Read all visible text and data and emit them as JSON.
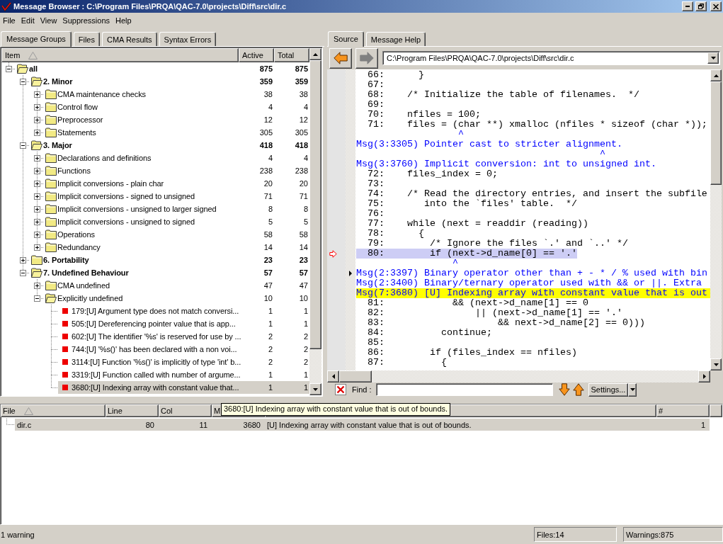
{
  "window": {
    "title": "Message Browser : C:\\Program Files\\PRQA\\QAC-7.0\\projects\\Diff\\src\\dir.c"
  },
  "menu": [
    "File",
    "Edit",
    "View",
    "Suppressions",
    "Help"
  ],
  "left_tabs": [
    {
      "label": "Message Groups",
      "selected": true
    },
    {
      "label": "Files",
      "selected": false
    },
    {
      "label": "CMA Results",
      "selected": false
    },
    {
      "label": "Syntax Errors",
      "selected": false
    }
  ],
  "message_groups": {
    "columns": [
      {
        "label": "Item",
        "sorted": true
      },
      {
        "label": "Active",
        "sorted": false
      },
      {
        "label": "Total",
        "sorted": false
      }
    ],
    "items": [
      {
        "kind": "group",
        "label": "all",
        "active": "875",
        "total": "875",
        "expanded": true,
        "selected": false,
        "children": [
          {
            "kind": "group",
            "label": "2. Minor",
            "active": "359",
            "total": "359",
            "expanded": true,
            "selected": false,
            "children": [
              {
                "kind": "group",
                "label": "CMA maintenance checks",
                "active": "38",
                "total": "38",
                "expanded": false,
                "selected": false
              },
              {
                "kind": "group",
                "label": "Control flow",
                "active": "4",
                "total": "4",
                "expanded": false,
                "selected": false
              },
              {
                "kind": "group",
                "label": "Preprocessor",
                "active": "12",
                "total": "12",
                "expanded": false,
                "selected": false
              },
              {
                "kind": "group",
                "label": "Statements",
                "active": "305",
                "total": "305",
                "expanded": false,
                "selected": false
              }
            ]
          },
          {
            "kind": "group",
            "label": "3. Major",
            "active": "418",
            "total": "418",
            "expanded": true,
            "selected": false,
            "children": [
              {
                "kind": "group",
                "label": "Declarations and definitions",
                "active": "4",
                "total": "4",
                "expanded": false,
                "selected": false
              },
              {
                "kind": "group",
                "label": "Functions",
                "active": "238",
                "total": "238",
                "expanded": false,
                "selected": false
              },
              {
                "kind": "group",
                "label": "Implicit conversions - plain char",
                "active": "20",
                "total": "20",
                "expanded": false,
                "selected": false
              },
              {
                "kind": "group",
                "label": "Implicit conversions - signed to unsigned",
                "active": "71",
                "total": "71",
                "expanded": false,
                "selected": false
              },
              {
                "kind": "group",
                "label": "Implicit conversions - unsigned to larger signed",
                "active": "8",
                "total": "8",
                "expanded": false,
                "selected": false
              },
              {
                "kind": "group",
                "label": "Implicit conversions - unsigned to signed",
                "active": "5",
                "total": "5",
                "expanded": false,
                "selected": false
              },
              {
                "kind": "group",
                "label": "Operations",
                "active": "58",
                "total": "58",
                "expanded": false,
                "selected": false
              },
              {
                "kind": "group",
                "label": "Redundancy",
                "active": "14",
                "total": "14",
                "expanded": false,
                "selected": false
              }
            ]
          },
          {
            "kind": "group",
            "label": "6. Portability",
            "active": "23",
            "total": "23",
            "expanded": false,
            "selected": false
          },
          {
            "kind": "group",
            "label": "7. Undefined Behaviour",
            "active": "57",
            "total": "57",
            "expanded": true,
            "selected": false,
            "children": [
              {
                "kind": "group",
                "label": "CMA undefined",
                "active": "47",
                "total": "47",
                "expanded": false,
                "selected": false
              },
              {
                "kind": "group",
                "label": "Explicitly undefined",
                "active": "10",
                "total": "10",
                "expanded": true,
                "selected": false,
                "children": [
                  {
                    "kind": "message",
                    "label": "179:[U] Argument type does not match conversi...",
                    "active": "1",
                    "total": "1",
                    "selected": false
                  },
                  {
                    "kind": "message",
                    "label": "505:[U] Dereferencing pointer value that is app...",
                    "active": "1",
                    "total": "1",
                    "selected": false
                  },
                  {
                    "kind": "message",
                    "label": "602:[U] The identifier '%s' is reserved for use by ...",
                    "active": "2",
                    "total": "2",
                    "selected": false
                  },
                  {
                    "kind": "message",
                    "label": "744:[U] '%s()' has been declared with a non voi...",
                    "active": "2",
                    "total": "2",
                    "selected": false
                  },
                  {
                    "kind": "message",
                    "label": "3114:[U] Function '%s()' is implicitly of type 'int' b...",
                    "active": "2",
                    "total": "2",
                    "selected": false
                  },
                  {
                    "kind": "message",
                    "label": "3319:[U] Function called with number of argume...",
                    "active": "1",
                    "total": "1",
                    "selected": false
                  },
                  {
                    "kind": "message",
                    "label": "3680:[U] Indexing array with constant value that...",
                    "active": "1",
                    "total": "1",
                    "selected": true
                  }
                ]
              }
            ]
          }
        ]
      }
    ]
  },
  "right_tabs": [
    {
      "label": "Source",
      "selected": true
    },
    {
      "label": "Message Help",
      "selected": false
    }
  ],
  "source": {
    "nav_buttons": [
      {
        "kind": "back",
        "disabled": false
      },
      {
        "kind": "forward",
        "disabled": true
      }
    ],
    "path": "C:\\Program Files\\PRQA\\QAC-7.0\\projects\\Diff\\src\\dir.c",
    "lines": [
      {
        "kind": "code",
        "number": "66:",
        "code": "      }",
        "highlighted": false,
        "current": false,
        "pointer": false
      },
      {
        "kind": "code",
        "number": "67:",
        "highlighted": false,
        "current": false,
        "pointer": false
      },
      {
        "kind": "code",
        "number": "68:",
        "code": "    /* Initialize the table of filenames.  */",
        "highlighted": false,
        "current": false,
        "pointer": false
      },
      {
        "kind": "code",
        "number": "69:",
        "highlighted": false,
        "current": false,
        "pointer": false
      },
      {
        "kind": "code",
        "number": "70:",
        "code": "    nfiles = 100;",
        "highlighted": false,
        "current": false,
        "pointer": false
      },
      {
        "kind": "code",
        "number": "71:",
        "code": "    files = (char **) xmalloc (nfiles * sizeof (char *));",
        "highlighted": false,
        "current": false,
        "pointer": false
      },
      {
        "kind": "caret",
        "code": "                  ^",
        "highlighted": false,
        "current": false,
        "pointer": false
      },
      {
        "kind": "message",
        "code": "Msg(3:3305) Pointer cast to stricter alignment.",
        "highlighted": false,
        "current": false,
        "pointer": false
      },
      {
        "kind": "caret",
        "code": "                                           ^",
        "highlighted": false,
        "current": false,
        "pointer": false
      },
      {
        "kind": "message",
        "code": "Msg(3:3760) Implicit conversion: int to unsigned int.",
        "highlighted": false,
        "current": false,
        "pointer": false
      },
      {
        "kind": "code",
        "number": "72:",
        "code": "    files_index = 0;",
        "highlighted": false,
        "current": false,
        "pointer": false
      },
      {
        "kind": "code",
        "number": "73:",
        "highlighted": false,
        "current": false,
        "pointer": false
      },
      {
        "kind": "code",
        "number": "74:",
        "code": "    /* Read the directory entries, and insert the subfile",
        "highlighted": false,
        "current": false,
        "pointer": false
      },
      {
        "kind": "code",
        "number": "75:",
        "code": "       into the `files' table.  */",
        "highlighted": false,
        "current": false,
        "pointer": false
      },
      {
        "kind": "code",
        "number": "76:",
        "highlighted": false,
        "current": false,
        "pointer": false
      },
      {
        "kind": "code",
        "number": "77:",
        "code": "    while (next = readdir (reading))",
        "highlighted": false,
        "current": false,
        "pointer": false
      },
      {
        "kind": "code",
        "number": "78:",
        "code": "      {",
        "highlighted": false,
        "current": false,
        "pointer": false
      },
      {
        "kind": "code",
        "number": "79:",
        "code": "        /* Ignore the files `.' and `..' */",
        "highlighted": false,
        "current": false,
        "pointer": false
      },
      {
        "kind": "code",
        "number": "80:",
        "code": "        if (next->d_name[0] == '.'",
        "highlighted": true,
        "current": true,
        "pointer": false
      },
      {
        "kind": "caret",
        "code": "                 ^",
        "highlighted": false,
        "current": false,
        "pointer": false
      },
      {
        "kind": "message",
        "code": "Msg(2:3397) Binary operator other than + - * / % used with bin",
        "highlighted": false,
        "current": false,
        "pointer": true
      },
      {
        "kind": "message",
        "code": "Msg(2:3400) Binary/ternary operator used with && or ||. Extra",
        "highlighted": false,
        "current": false,
        "pointer": false
      },
      {
        "kind": "message",
        "code": "Msg(7:3680) [U] Indexing array with constant value that is out",
        "highlighted": true,
        "current": false,
        "pointer": false
      },
      {
        "kind": "code",
        "number": "81:",
        "code": "            && (next->d_name[1] == 0",
        "highlighted": false,
        "current": false,
        "pointer": false
      },
      {
        "kind": "code",
        "number": "82:",
        "code": "                || (next->d_name[1] == '.'",
        "highlighted": false,
        "current": false,
        "pointer": false
      },
      {
        "kind": "code",
        "number": "83:",
        "code": "                    && next->d_name[2] == 0)))",
        "highlighted": false,
        "current": false,
        "pointer": false
      },
      {
        "kind": "code",
        "number": "84:",
        "code": "          continue;",
        "highlighted": false,
        "current": false,
        "pointer": false
      },
      {
        "kind": "code",
        "number": "85:",
        "highlighted": false,
        "current": false,
        "pointer": false
      },
      {
        "kind": "code",
        "number": "86:",
        "code": "        if (files_index == nfiles)",
        "highlighted": false,
        "current": false,
        "pointer": false
      },
      {
        "kind": "code",
        "number": "87:",
        "code": "          {",
        "highlighted": false,
        "current": false,
        "pointer": false
      }
    ]
  },
  "find": {
    "label": "Find :",
    "settings": "Settings..."
  },
  "results": {
    "columns": [
      {
        "label": "File",
        "sorted": true
      },
      {
        "label": "Line",
        "sorted": false
      },
      {
        "label": "Col",
        "sorted": false
      },
      {
        "label": "M"
      },
      {
        "sorted": false
      },
      {
        "label": "#",
        "sorted": false
      }
    ],
    "rows": [
      {
        "file": "dir.c",
        "line": "80",
        "col": "11",
        "msg": "3680",
        "text": "[U] Indexing array with constant value that is out of bounds.",
        "count": "1",
        "selected": true
      }
    ]
  },
  "tooltip": "3680:[U] Indexing array with constant value that is out of bounds.",
  "status_bar": {
    "message": "1 warning",
    "files": "Files:14",
    "warnings": "Warnings:875"
  }
}
